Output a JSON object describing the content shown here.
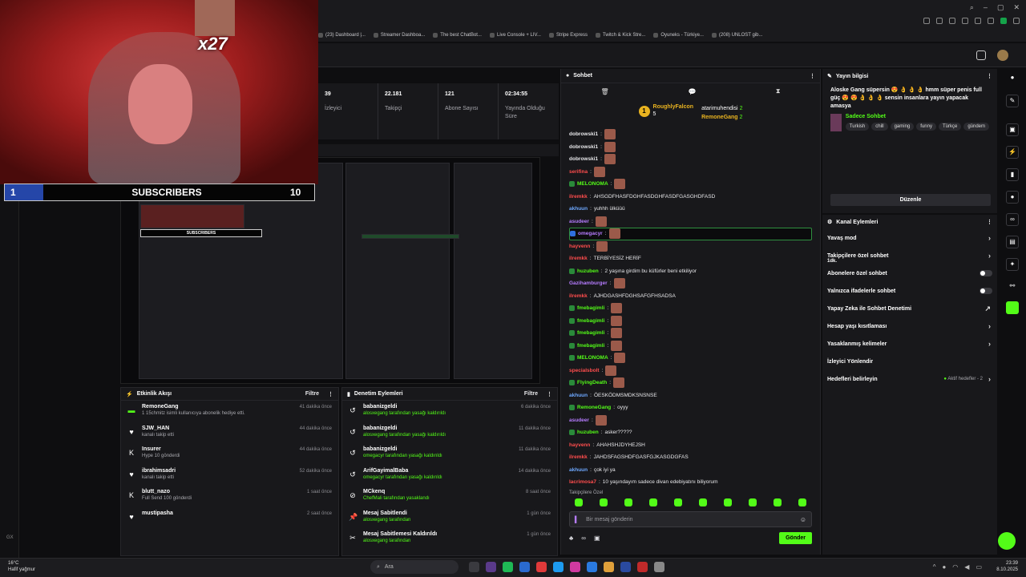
{
  "browser": {
    "bookmarks": [
      "(23) Dashboard |...",
      "Streamer Dashboa...",
      "The best ChatBot...",
      "Live Console + LIV...",
      "Stripe Express",
      "Twitch & Kick Stre...",
      "Oyuneks - Türkiye...",
      "(208) UNLOST gib..."
    ],
    "left_label": "GX"
  },
  "cam": {
    "multiplier": "x27"
  },
  "subs_bar": {
    "current": "1",
    "label": "SUBSCRIBERS",
    "goal": "10"
  },
  "stats": [
    {
      "value": "39",
      "label": "İzleyici"
    },
    {
      "value": "22.181",
      "label": "Takipçi"
    },
    {
      "value": "121",
      "label": "Abone Sayısı"
    },
    {
      "value": "02:34:55",
      "label": "Yayında Olduğu Süre"
    }
  ],
  "activity": {
    "title": "Etkinlik Akışı",
    "filter": "Filtre",
    "items": [
      {
        "name": "RemoneGang",
        "sub": "1 15chmitz isimli kullanıcıya abonelik hediye etti.",
        "time": "41 dakika önce",
        "icon": "gift-icon"
      },
      {
        "name": "SJW_HAN",
        "sub": "kanalı takip etti",
        "time": "44 dakika önce",
        "icon": "heart-icon"
      },
      {
        "name": "Insurer",
        "sub": "Hype 10 gönderdi",
        "time": "44 dakika önce",
        "icon": "kick-icon"
      },
      {
        "name": "ibrahimsadri",
        "sub": "kanalı takip etti",
        "time": "52 dakika önce",
        "icon": "heart-icon"
      },
      {
        "name": "blutt_nazo",
        "sub": "Full Send 100 gönderdi",
        "time": "1 saat önce",
        "icon": "kick-icon"
      },
      {
        "name": "mustipasha",
        "sub": "",
        "time": "2 saat önce",
        "icon": "heart-icon"
      }
    ]
  },
  "moderation": {
    "title": "Denetim Eylemleri",
    "filter": "Filtre",
    "items": [
      {
        "name": "babanizgeldi",
        "sub": "alosxegang tarafından yasağı kaldırıldı",
        "time": "6 dakika önce"
      },
      {
        "name": "babanizgeldi",
        "sub": "alosxegang tarafından yasağı kaldırıldı",
        "time": "11 dakika önce"
      },
      {
        "name": "babanizgeldi",
        "sub": "omegacyr tarafından yasağı kaldırıldı",
        "time": "11 dakika önce"
      },
      {
        "name": "ArifGayimalBaba",
        "sub": "omegacyr tarafından yasağı kaldırıldı",
        "time": "14 dakika önce"
      },
      {
        "name": "MCkenq",
        "sub": "ChefMali tarafından yasaklandı",
        "time": "8 saat önce"
      },
      {
        "name": "Mesaj Sabitlendi",
        "sub": "alosxegang tarafından",
        "time": "1 gün önce"
      },
      {
        "name": "Mesaj Sabitlemesi Kaldırıldı",
        "sub": "alosxegang tarafından",
        "time": "1 gün önce"
      }
    ]
  },
  "chat": {
    "title": "Sohbet",
    "leader": {
      "rank": "1",
      "name": "RoughlyFalcon",
      "count": "5",
      "second": "atarimuhendisi",
      "second_count": "2",
      "third": "RemoneGang",
      "third_count": "2"
    },
    "messages": [
      {
        "user": "dobrowski1",
        "color": "#e7e7ea",
        "text": "",
        "emote": true
      },
      {
        "user": "dobrowski1",
        "color": "#e7e7ea",
        "text": "",
        "emote": true
      },
      {
        "user": "dobrowski1",
        "color": "#e7e7ea",
        "text": "",
        "emote": true
      },
      {
        "user": "serifina",
        "color": "#ff4d4d",
        "text": "",
        "emote": true
      },
      {
        "user": "MELONOMA",
        "color": "#53fc18",
        "text": "",
        "emote": true
      },
      {
        "user": "ilremkk",
        "color": "#ff4d4d",
        "text": "AHSGDFHASFDGHFASDGHFASDFGASGHDFASD",
        "emote": false
      },
      {
        "user": "akhuun",
        "color": "#6ea8ff",
        "text": "yuhhh ülküüü",
        "emote": false
      },
      {
        "user": "asudeer",
        "color": "#b67cff",
        "text": "",
        "emote": true
      },
      {
        "user": "omegacyr",
        "color": "#b67cff",
        "text": "",
        "emote": true,
        "highlight": true
      },
      {
        "user": "hayvenn",
        "color": "#ff4d4d",
        "text": "",
        "emote": true
      },
      {
        "user": "ilremkk",
        "color": "#ff4d4d",
        "text": "TERBİYESİZ HERİF",
        "emote": false
      },
      {
        "user": "huzuben",
        "color": "#53fc18",
        "text": "2 yaşına girdim bu küfürler beni etkiliyor",
        "emote": false
      },
      {
        "user": "Gazihamburger",
        "color": "#b67cff",
        "text": "",
        "emote": true
      },
      {
        "user": "ilremkk",
        "color": "#ff4d4d",
        "text": "AJHDGASHFDGHSAFGFHSADSA",
        "emote": false
      },
      {
        "user": "fmebagimli",
        "color": "#53fc18",
        "text": "",
        "emote": true
      },
      {
        "user": "fmebagimli",
        "color": "#53fc18",
        "text": "",
        "emote": true
      },
      {
        "user": "fmebagimli",
        "color": "#53fc18",
        "text": "",
        "emote": true
      },
      {
        "user": "fmebagimli",
        "color": "#53fc18",
        "text": "",
        "emote": true
      },
      {
        "user": "MELONOMA",
        "color": "#53fc18",
        "text": "",
        "emote": true
      },
      {
        "user": "specialsbolt",
        "color": "#ff4d4d",
        "text": "",
        "emote": true
      },
      {
        "user": "FlyingDeath",
        "color": "#53fc18",
        "text": "",
        "emote": true
      },
      {
        "user": "akhuun",
        "color": "#6ea8ff",
        "text": "ÖESKÖDMSMDKSNSNSE",
        "emote": false
      },
      {
        "user": "RemoneGang",
        "color": "#53fc18",
        "text": "oyyy",
        "emote": false
      },
      {
        "user": "asudeer",
        "color": "#b67cff",
        "text": "",
        "emote": true
      },
      {
        "user": "huzuben",
        "color": "#53fc18",
        "text": "asker?????",
        "emote": false
      },
      {
        "user": "hayvenn",
        "color": "#ff4d4d",
        "text": "AHAHSHJDYHEJSH",
        "emote": false
      },
      {
        "user": "ilremkk",
        "color": "#ff4d4d",
        "text": "JAHDSFAGSHDFGASFGJKASGDGFAS",
        "emote": false
      },
      {
        "user": "akhuun",
        "color": "#6ea8ff",
        "text": "çok iyi ya",
        "emote": false
      },
      {
        "user": "lacrimosa7",
        "color": "#ff4d4d",
        "text": "10 yaşındayım sadece divan edebiyatını biliyorum",
        "emote": false
      }
    ],
    "followers_only": "Takipçilere Özel",
    "input_placeholder": "Bir mesaj gönderin",
    "send_label": "Gönder"
  },
  "info": {
    "title": "Yayın bilgisi",
    "stream_title": "Aloske Gang süpersin 😍 👌 👌 👌 hmm süper penis full güç 😍 😍 👌 👌 👌 sensin insanlara yayın yapacak amasya",
    "category": "Sadece Sohbet",
    "tags": [
      "Turkish",
      "chill",
      "gaming",
      "funny",
      "Türkçe",
      "gündem"
    ],
    "edit_label": "Düzenle"
  },
  "actions": {
    "title": "Kanal Eylemleri",
    "items": [
      {
        "label": "Yavaş mod",
        "kind": "chevron",
        "sub": ""
      },
      {
        "label": "Takipçilere özel sohbet",
        "kind": "chevron",
        "sub": "1dk."
      },
      {
        "label": "Abonelere özel sohbet",
        "kind": "toggle",
        "sub": ""
      },
      {
        "label": "Yalnızca ifadelerle sohbet",
        "kind": "toggle",
        "sub": ""
      },
      {
        "label": "Yapay Zeka ile Sohbet Denetimi",
        "kind": "external",
        "sub": ""
      },
      {
        "label": "Hesap yaşı kısıtlaması",
        "kind": "chevron",
        "sub": ""
      },
      {
        "label": "Yasaklanmış kelimeler",
        "kind": "chevron",
        "sub": ""
      },
      {
        "label": "İzleyici Yönlendir",
        "kind": "none",
        "sub": ""
      },
      {
        "label": "Hedefleri belirleyin",
        "kind": "goals",
        "sub": "",
        "goals": "Aktif hedefler - 2"
      }
    ]
  },
  "taskbar": {
    "temp": "16°C",
    "weather": "Hafif yağmur",
    "search": "Ara",
    "time": "23:39",
    "date": "8.10.2025"
  },
  "colors": {
    "accent": "#53fc18",
    "panel": "#18181b",
    "bg": "#0e0e10"
  }
}
